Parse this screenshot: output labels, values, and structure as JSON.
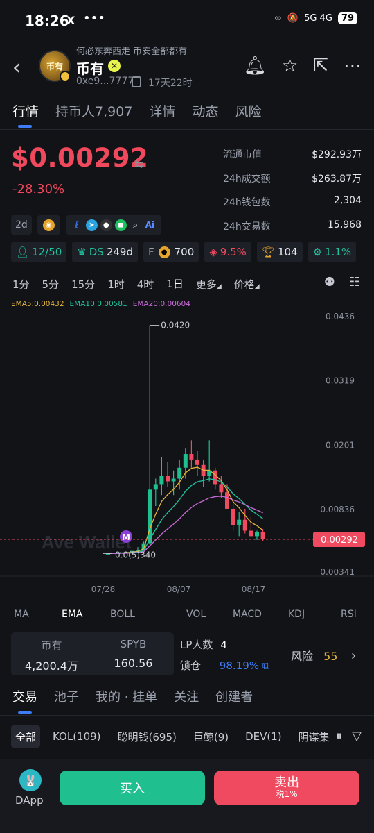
{
  "status_bar": {
    "time": "18:26",
    "x_label": "X",
    "dots": "•••",
    "right": "5G 4G",
    "battery": "79"
  },
  "header": {
    "tagline": "何必东奔西走 币安全部都有",
    "token_name": "币有",
    "address": "0xe9...7777",
    "age": "17天22时",
    "avatar_text": "币有"
  },
  "tabs": [
    {
      "label": "行情"
    },
    {
      "label": "持币人7,907"
    },
    {
      "label": "详情"
    },
    {
      "label": "动态"
    },
    {
      "label": "风险"
    }
  ],
  "price": {
    "value": "$0.00292",
    "change": "-28.30%"
  },
  "stats": [
    {
      "label": "流通市值",
      "value": "$292.93万"
    },
    {
      "label": "24h成交额",
      "value": "$263.87万"
    },
    {
      "label": "24h钱包数",
      "value": "2,304"
    },
    {
      "label": "24h交易数",
      "value": "15,968"
    }
  ],
  "socials": {
    "age_chip": "2d"
  },
  "metrics": [
    {
      "icon": "holders-icon",
      "text": "12/50",
      "color": "#22c3a0"
    },
    {
      "icon": "ds-icon",
      "text": "DS",
      "text2": "249d",
      "color": "#22c3a0"
    },
    {
      "icon": "f-icon",
      "text": "F",
      "text2": "700",
      "color": "#e6e8ee"
    },
    {
      "icon": "layers-icon",
      "text": "9.5%",
      "color": "#f0485d"
    },
    {
      "icon": "trophy-icon",
      "text": "104",
      "color": "#e6e8ee"
    },
    {
      "icon": "gear-badge-icon",
      "text": "1.1%",
      "color": "#22c3a0"
    }
  ],
  "timeframes": [
    "1分",
    "5分",
    "15分",
    "1时",
    "4时",
    "1日",
    "更多",
    "价格"
  ],
  "chart_data": {
    "type": "candlestick",
    "ema_legend": [
      "EMA5:0.00432",
      "EMA10:0.00581",
      "EMA20:0.00604"
    ],
    "y_ticks": [
      "0.0436",
      "0.0319",
      "0.0201",
      "0.00836",
      "0.00341"
    ],
    "x_ticks": [
      "07/28",
      "08/07",
      "08/17"
    ],
    "current_price": "0.00292",
    "high_label": "0.0420",
    "low_label": "0.0(5)340",
    "marker": "M",
    "watermark": "Ave Wallet",
    "candles": [
      [
        0.00034,
        0.00034,
        0.00034,
        0.00034
      ],
      [
        0.00034,
        0.0005,
        0.00034,
        0.00045
      ],
      [
        0.00045,
        0.0006,
        0.0004,
        0.0005
      ],
      [
        0.0005,
        0.0007,
        0.0004,
        0.0006
      ],
      [
        0.0006,
        0.001,
        0.0005,
        0.0008
      ],
      [
        0.0008,
        0.0015,
        0.0006,
        0.001
      ],
      [
        0.001,
        0.0025,
        0.0009,
        0.0022
      ],
      [
        0.0022,
        0.042,
        0.002,
        0.012
      ],
      [
        0.012,
        0.014,
        0.009,
        0.013
      ],
      [
        0.013,
        0.018,
        0.011,
        0.0145
      ],
      [
        0.0145,
        0.017,
        0.0125,
        0.0135
      ],
      [
        0.0135,
        0.0155,
        0.011,
        0.014
      ],
      [
        0.014,
        0.0175,
        0.012,
        0.016
      ],
      [
        0.016,
        0.0195,
        0.014,
        0.0185
      ],
      [
        0.0185,
        0.021,
        0.016,
        0.0175
      ],
      [
        0.0175,
        0.019,
        0.0145,
        0.0165
      ],
      [
        0.0165,
        0.0175,
        0.0125,
        0.0145
      ],
      [
        0.0145,
        0.021,
        0.0135,
        0.0155
      ],
      [
        0.0155,
        0.016,
        0.012,
        0.013
      ],
      [
        0.013,
        0.0145,
        0.0105,
        0.0115
      ],
      [
        0.0115,
        0.013,
        0.0085,
        0.0085
      ],
      [
        0.0085,
        0.0095,
        0.0045,
        0.0055
      ],
      [
        0.0055,
        0.008,
        0.0035,
        0.0065
      ],
      [
        0.0065,
        0.0085,
        0.004,
        0.0045
      ],
      [
        0.0045,
        0.007,
        0.0035,
        0.0035
      ],
      [
        0.0035,
        0.0045,
        0.0028,
        0.0042
      ],
      [
        0.0042,
        0.0048,
        0.0026,
        0.00292
      ]
    ]
  },
  "indicators": [
    "MA",
    "EMA",
    "BOLL",
    "VOL",
    "MACD",
    "KDJ",
    "RSI"
  ],
  "market": {
    "pair_a_label": "币有",
    "pair_a_value": "4,200.4万",
    "pair_b_label": "SPYB",
    "pair_b_value": "160.56",
    "lp_label": "LP人数",
    "lp_value": "4",
    "lock_label": "锁仓",
    "lock_value": "98.19%",
    "risk_label": "风险",
    "risk_value": "55"
  },
  "bottom_tabs": [
    "交易",
    "池子",
    "我的 · 挂单",
    "关注",
    "创建者"
  ],
  "filters": [
    "全部",
    "KOL(109)",
    "聪明钱(695)",
    "巨鲸(9)",
    "DEV(1)",
    "阴谋集"
  ],
  "actions": {
    "dapp": "DApp",
    "buy": "买入",
    "sell": "卖出",
    "sell_tax": "税1%"
  }
}
